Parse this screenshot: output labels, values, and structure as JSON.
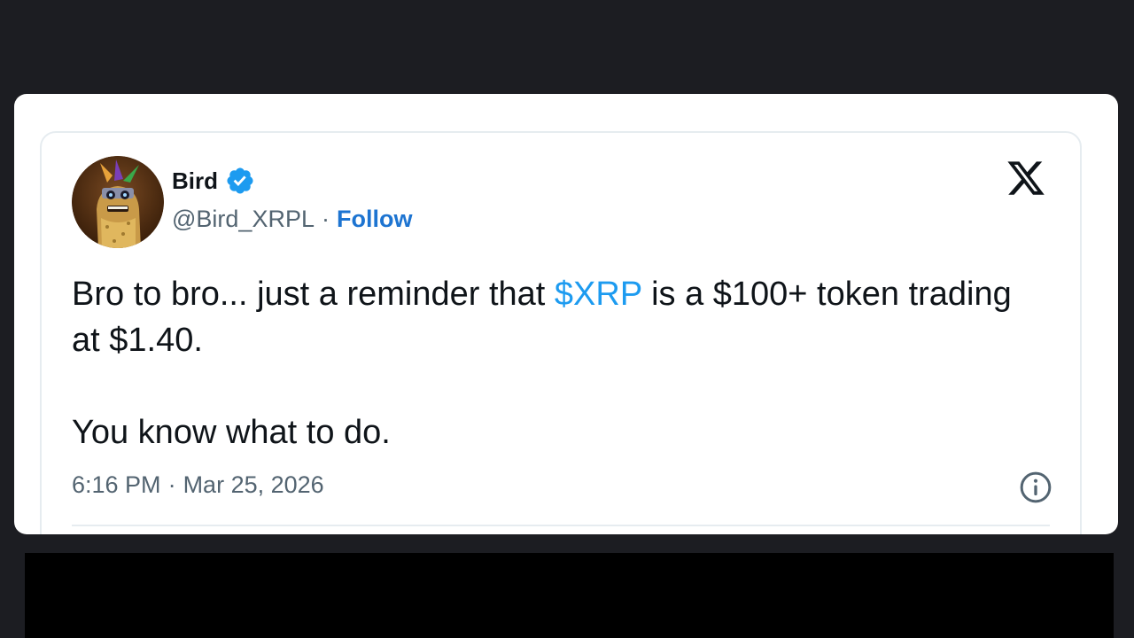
{
  "tweet": {
    "display_name": "Bird",
    "handle": "@Bird_XRPL",
    "separator": "·",
    "follow_label": "Follow",
    "body": {
      "line1_prefix": "Bro to bro... just a reminder that ",
      "cashtag": "$XRP",
      "line1_suffix": " is a $100+ token trading at $1.40.",
      "line2": "You know what to do."
    },
    "time": "6:16 PM",
    "date": "Mar 25, 2026"
  },
  "icons": {
    "platform_logo": "x-logo-icon",
    "verified": "verified-badge-icon",
    "info": "info-icon"
  },
  "colors": {
    "background": "#1c1d22",
    "card": "#ffffff",
    "link": "#1d9bf0",
    "follow": "#1d74d1",
    "verified": "#1d9bf0",
    "secondary_text": "#536471"
  }
}
